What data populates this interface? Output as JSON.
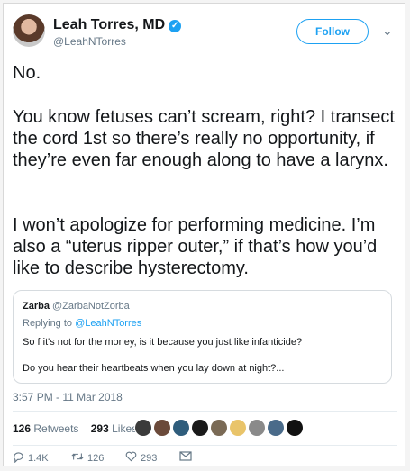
{
  "user": {
    "name": "Leah Torres, MD",
    "handle": "@LeahNTorres",
    "verified_glyph": "✓",
    "follow_label": "Follow",
    "menu_glyph": "⌄"
  },
  "tweet": {
    "line1": "No.",
    "para2": "You know fetuses can’t scream, right? I transect the cord 1st so there’s really no opportunity, if they’re even far enough along to have a larynx.",
    "para3": "I won’t apologize for performing medicine. I’m also a “uterus ripper outer,” if that’s how you’d like to describe hysterectomy."
  },
  "quoted": {
    "name": "Zarba",
    "handle": "@ZarbaNotZorba",
    "replying_prefix": "Replying to",
    "replying_to": "@LeahNTorres",
    "text1": "So f it's not for the money, is it because you just like infanticide?",
    "text2": "Do you hear their heartbeats when you lay down at night?..."
  },
  "timestamp": "3:57 PM - 11 Mar 2018",
  "stats": {
    "retweets_count": "126",
    "retweets_label": "Retweets",
    "likes_count": "293",
    "likes_label": "Likes"
  },
  "likers": [
    "#3b3b3b",
    "#6b4a3a",
    "#2f5d7c",
    "#1a1a1a",
    "#7a6a55",
    "#e9c46a",
    "#8a8a8a",
    "#4a6b8a",
    "#111111"
  ],
  "actions": {
    "reply_icon": "reply-icon",
    "reply_count": "1.4K",
    "retweet_icon": "retweet-icon",
    "retweet_count": "126",
    "like_icon": "heart-icon",
    "like_count": "293",
    "dm_icon": "mail-icon"
  }
}
